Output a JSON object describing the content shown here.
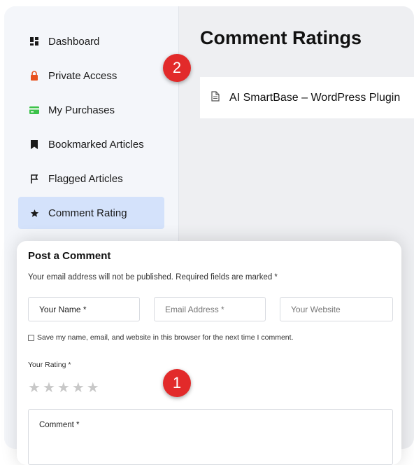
{
  "sidebar": {
    "items": [
      {
        "label": "Dashboard",
        "icon": "dashboard-icon"
      },
      {
        "label": "Private Access",
        "icon": "lock-icon"
      },
      {
        "label": "My Purchases",
        "icon": "credit-card-icon"
      },
      {
        "label": "Bookmarked Articles",
        "icon": "bookmark-icon"
      },
      {
        "label": "Flagged Articles",
        "icon": "flag-icon"
      },
      {
        "label": "Comment Rating",
        "icon": "star-icon",
        "active": true
      }
    ]
  },
  "main": {
    "title": "Comment Ratings",
    "plugin": {
      "label": "AI SmartBase – WordPress Plugin",
      "icon": "document-icon"
    }
  },
  "badges": {
    "one": "1",
    "two": "2"
  },
  "comment_form": {
    "title": "Post a Comment",
    "note": "Your email address will not be published. Required fields are marked *",
    "name_field": "Your Name *",
    "email_placeholder": "Email Address *",
    "website_placeholder": "Your Website",
    "save_label": "Save my name, email, and website in this browser for the next time I comment.",
    "rating_label": "Your Rating *",
    "rating_value": 0,
    "rating_max": 5,
    "comment_label": "Comment *"
  },
  "colors": {
    "accent_red": "#e22a2a",
    "active_bg": "#d4e2fb",
    "lock_orange": "#e8501c",
    "card_green": "#3cc24a"
  }
}
